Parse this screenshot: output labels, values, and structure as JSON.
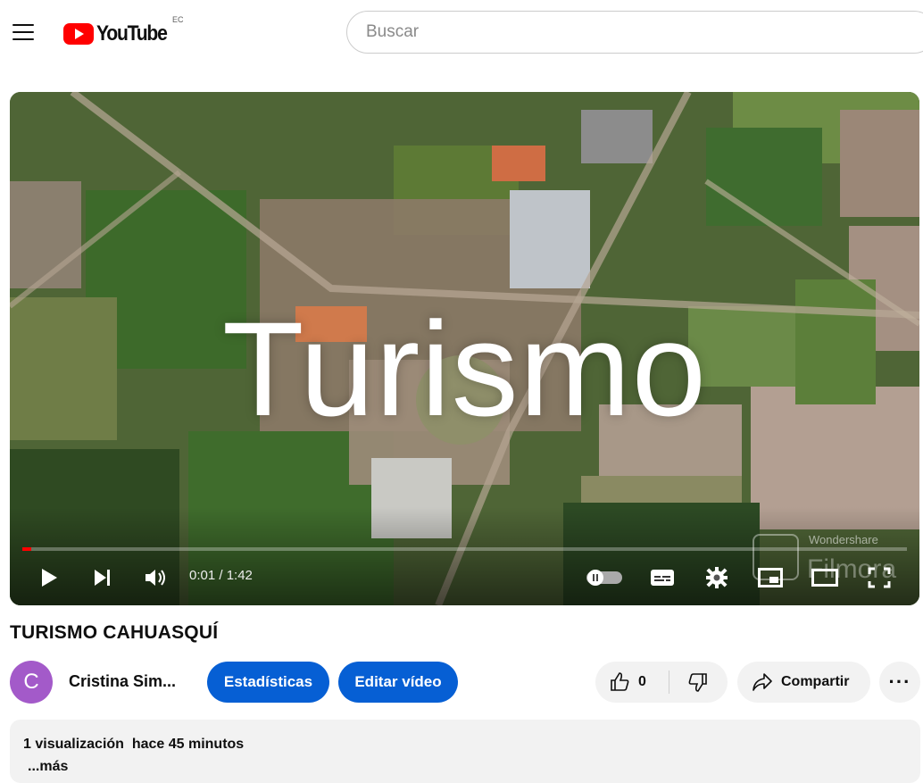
{
  "header": {
    "logo_text": "YouTube",
    "country_code": "EC",
    "search_placeholder": "Buscar"
  },
  "player": {
    "overlay_text": "Turismo",
    "time_display": "0:01 / 1:42",
    "progress_fraction": 0.01,
    "watermark_top": "Wondershare",
    "watermark_bottom": "Filmora",
    "accent_color": "#ff0000"
  },
  "video": {
    "title": "TURISMO CAHUASQUÍ",
    "channel_initial": "C",
    "channel_name": "Cristina Sim...",
    "stats_button": "Estadísticas",
    "edit_button": "Editar vídeo",
    "like_count": "0",
    "share_label": "Compartir",
    "more_glyph": "···"
  },
  "description": {
    "stats": "1 visualización  hace 45 minutos",
    "more_link": "...más"
  },
  "colors": {
    "brand_red": "#ff0000",
    "button_blue": "#065fd4",
    "avatar_purple": "#a35ac9",
    "chip_grey": "#f2f2f2"
  }
}
